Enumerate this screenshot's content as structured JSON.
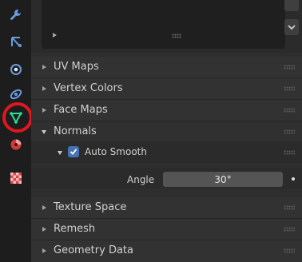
{
  "properties": {
    "sections": [
      {
        "label": "UV Maps"
      },
      {
        "label": "Vertex Colors"
      },
      {
        "label": "Face Maps"
      },
      {
        "label": "Normals"
      },
      {
        "label": "Texture Space"
      },
      {
        "label": "Remesh"
      },
      {
        "label": "Geometry Data"
      }
    ],
    "normals": {
      "auto_smooth_label": "Auto Smooth",
      "auto_smooth_checked": true,
      "angle_label": "Angle",
      "angle_value": "30°"
    }
  },
  "tabs": [
    {
      "icon": "wrench-icon"
    },
    {
      "icon": "particles-icon"
    },
    {
      "icon": "physics-icon"
    },
    {
      "icon": "object-constraint-icon"
    },
    {
      "icon": "object-data-mesh-icon",
      "active": true
    },
    {
      "icon": "material-icon"
    },
    {
      "icon": "texture-icon"
    }
  ],
  "colors": {
    "accent": "#4772b3",
    "highlight_ring": "#e0171f",
    "mesh_icon": "#2fdc96"
  }
}
